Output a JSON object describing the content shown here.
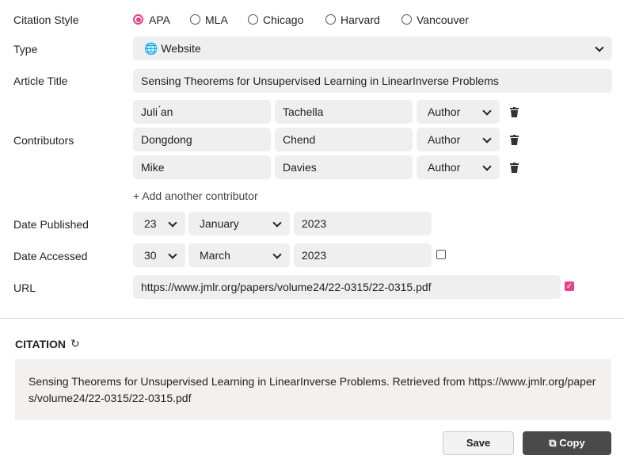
{
  "labels": {
    "style": "Citation Style",
    "type": "Type",
    "title": "Article Title",
    "contributors": "Contributors",
    "published": "Date Published",
    "accessed": "Date Accessed",
    "url": "URL"
  },
  "styles": [
    {
      "label": "APA",
      "selected": true
    },
    {
      "label": "MLA",
      "selected": false
    },
    {
      "label": "Chicago",
      "selected": false
    },
    {
      "label": "Harvard",
      "selected": false
    },
    {
      "label": "Vancouver",
      "selected": false
    }
  ],
  "type": {
    "icon": "globe-icon",
    "value": "Website"
  },
  "article_title": "Sensing Theorems for Unsupervised Learning in LinearInverse Problems",
  "contributors": [
    {
      "first": "Juli ́an",
      "last": "Tachella",
      "role": "Author"
    },
    {
      "first": "Dongdong",
      "last": "Chend",
      "role": "Author"
    },
    {
      "first": "Mike",
      "last": "Davies",
      "role": "Author"
    }
  ],
  "add_contributor": "+ Add another contributor",
  "published": {
    "day": "23",
    "month": "January",
    "year": "2023"
  },
  "accessed": {
    "day": "30",
    "month": "March",
    "year": "2023",
    "checked": false
  },
  "url": {
    "value": "https://www.jmlr.org/papers/volume24/22-0315/22-0315.pdf",
    "checked": true
  },
  "citation": {
    "heading": "CITATION",
    "text": "Sensing Theorems for Unsupervised Learning in LinearInverse Problems. Retrieved from https://www.jmlr.org/papers/volume24/22-0315/22-0315.pdf"
  },
  "buttons": {
    "save": "Save",
    "copy": "Copy"
  },
  "colors": {
    "accent": "#e8408a",
    "field": "#efefef",
    "dark_button": "#4a4a4a"
  }
}
